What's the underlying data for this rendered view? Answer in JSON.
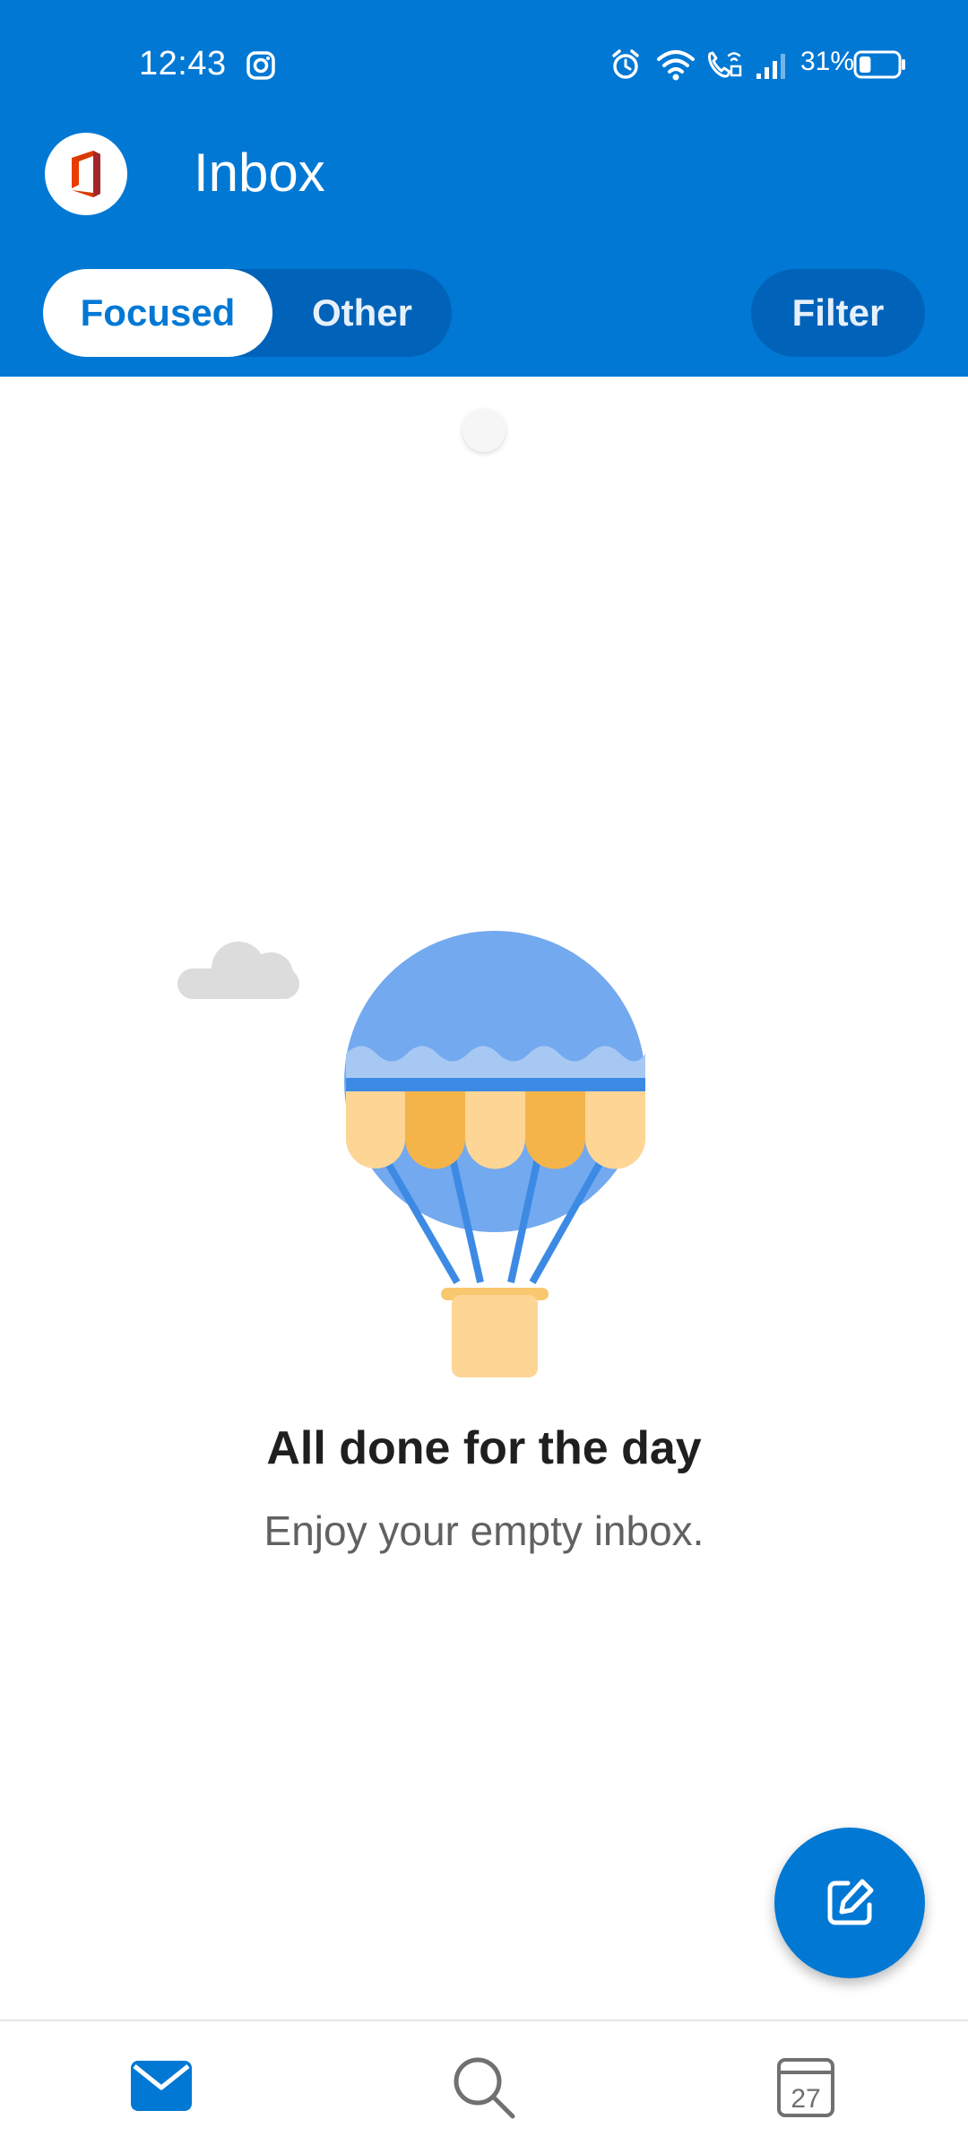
{
  "status_bar": {
    "time": "12:43",
    "battery_percent": "31%",
    "battery_level": 0.31,
    "icons": [
      "instagram-icon",
      "alarm-icon",
      "wifi-icon",
      "wifi-calling-icon",
      "signal-icon",
      "battery-icon"
    ]
  },
  "header": {
    "title": "Inbox",
    "logo_icon": "office-logo-icon",
    "background_color": "#0078d4"
  },
  "tabs": [
    {
      "label": "Focused",
      "active": true
    },
    {
      "label": "Other",
      "active": false
    }
  ],
  "filter_label": "Filter",
  "empty_state": {
    "title": "All done for the day",
    "subtitle": "Enjoy your empty inbox.",
    "illustration": "hot-air-balloon-illustration"
  },
  "compose_icon": "compose-icon",
  "bottom_nav": {
    "items": [
      {
        "icon": "mail-icon",
        "active": true
      },
      {
        "icon": "search-icon",
        "active": false
      },
      {
        "icon": "calendar-icon",
        "active": false,
        "date": "27"
      }
    ]
  },
  "colors": {
    "accent": "#0078d4",
    "tab_track": "#0062b8",
    "balloon_blue": "#73a9ee",
    "balloon_orange": "#f5b44a",
    "balloon_light": "#fdd595"
  }
}
